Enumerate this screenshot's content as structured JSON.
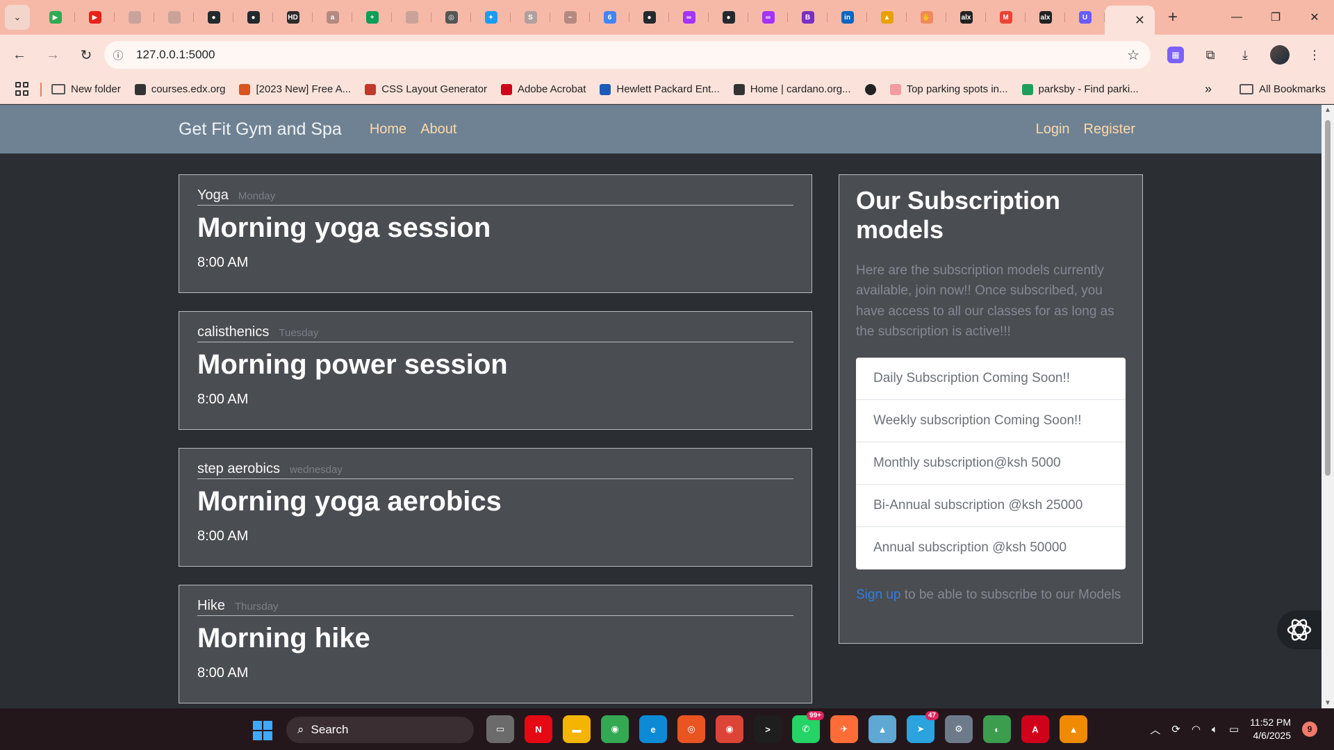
{
  "browser": {
    "tab_favicons": [
      {
        "icon": "google-play-icon",
        "color": "#34a853",
        "glyph": "▶"
      },
      {
        "icon": "youtube-icon",
        "color": "#e62117",
        "glyph": "▶"
      },
      {
        "icon": "blank-globe-icon",
        "color": "#c9a39a",
        "glyph": ""
      },
      {
        "icon": "blank-globe-icon",
        "color": "#c9a39a",
        "glyph": ""
      },
      {
        "icon": "github-icon",
        "color": "#24292e",
        "glyph": "●"
      },
      {
        "icon": "github-icon",
        "color": "#24292e",
        "glyph": "●"
      },
      {
        "icon": "hd-icon",
        "color": "#2d2d2d",
        "glyph": "HD"
      },
      {
        "icon": "alx-icon",
        "color": "#b48a80",
        "glyph": "a"
      },
      {
        "icon": "sheets-plus-icon",
        "color": "#0f9d58",
        "glyph": "+"
      },
      {
        "icon": "blank-globe-icon",
        "color": "#c9a39a",
        "glyph": ""
      },
      {
        "icon": "target-icon",
        "color": "#555555",
        "glyph": "◎"
      },
      {
        "icon": "twitter-icon",
        "color": "#1d9bf0",
        "glyph": "✦"
      },
      {
        "icon": "s-circle-icon",
        "color": "#b0a09c",
        "glyph": "S"
      },
      {
        "icon": "dash-icon",
        "color": "#b48a80",
        "glyph": "~"
      },
      {
        "icon": "google-calendar-icon",
        "color": "#4285f4",
        "glyph": "6"
      },
      {
        "icon": "github-icon",
        "color": "#24292e",
        "glyph": "●"
      },
      {
        "icon": "messenger-icon",
        "color": "#a334fa",
        "glyph": "∞"
      },
      {
        "icon": "github-icon",
        "color": "#24292e",
        "glyph": "●"
      },
      {
        "icon": "messenger-icon",
        "color": "#a334fa",
        "glyph": "∞"
      },
      {
        "icon": "b-icon",
        "color": "#7b2fbe",
        "glyph": "B"
      },
      {
        "icon": "linkedin-icon",
        "color": "#0a66c2",
        "glyph": "in"
      },
      {
        "icon": "charts-icon",
        "color": "#e8a200",
        "glyph": "▲"
      },
      {
        "icon": "hand-icon",
        "color": "#f08a5d",
        "glyph": "✋"
      },
      {
        "icon": "alx-icon",
        "color": "#222222",
        "glyph": "alx"
      },
      {
        "icon": "gmail-icon",
        "color": "#ea4335",
        "glyph": "M"
      },
      {
        "icon": "alx-icon",
        "color": "#222222",
        "glyph": "alx"
      },
      {
        "icon": "u-icon",
        "color": "#6a5cff",
        "glyph": "U"
      }
    ],
    "address": "127.0.0.1:5000",
    "bookmarks": [
      {
        "label": "New folder",
        "color": "#555555"
      },
      {
        "label": "courses.edx.org",
        "color": "#333333"
      },
      {
        "label": "[2023 New] Free A...",
        "color": "#d9541e"
      },
      {
        "label": "CSS Layout Generator",
        "color": "#c0392b"
      },
      {
        "label": "Adobe Acrobat",
        "color": "#d0021b"
      },
      {
        "label": "Hewlett Packard Ent...",
        "color": "#1c5bb7"
      },
      {
        "label": "Home | cardano.org...",
        "color": "#333333"
      },
      {
        "label": "",
        "color": "#222222"
      },
      {
        "label": "Top parking spots in...",
        "color": "#f39ca0"
      },
      {
        "label": "parksby - Find parki...",
        "color": "#1e9e5a"
      }
    ],
    "all_bookmarks_label": "All Bookmarks",
    "more_label": "»"
  },
  "site": {
    "brand": "Get Fit Gym and Spa",
    "nav": {
      "home": "Home",
      "about": "About",
      "login": "Login",
      "register": "Register"
    }
  },
  "classes": [
    {
      "category": "Yoga",
      "day": "Monday",
      "title": "Morning yoga session",
      "time": "8:00 AM"
    },
    {
      "category": "calisthenics",
      "day": "Tuesday",
      "title": "Morning power session",
      "time": "8:00 AM"
    },
    {
      "category": "step aerobics",
      "day": "wednesday",
      "title": "Morning yoga aerobics",
      "time": "8:00 AM"
    },
    {
      "category": "Hike",
      "day": "Thursday",
      "title": "Morning hike",
      "time": "8:00 AM"
    }
  ],
  "subscriptions": {
    "title": "Our Subscription models",
    "description": "Here are the subscription models currently available, join now!! Once subscribed, you have access to all our classes for as long as the subscription is active!!!",
    "items": [
      "Daily Subscription Coming Soon!!",
      "Weekly subscription Coming Soon!!",
      "Monthly subscription@ksh 5000",
      "Bi-Annual subscription @ksh 25000",
      "Annual subscription @ksh 50000"
    ],
    "signup_link": "Sign up",
    "signup_text": " to be able to subscribe to our Models"
  },
  "taskbar": {
    "search_label": "Search",
    "apps": [
      {
        "icon": "task-view-icon",
        "color": "#6b6b6b",
        "glyph": "▭",
        "badge": ""
      },
      {
        "icon": "netflix-icon",
        "color": "#e50914",
        "glyph": "N",
        "badge": ""
      },
      {
        "icon": "file-explorer-icon",
        "color": "#f4b400",
        "glyph": "▬",
        "badge": ""
      },
      {
        "icon": "chrome-icon",
        "color": "#34a853",
        "glyph": "◉",
        "badge": ""
      },
      {
        "icon": "edge-icon",
        "color": "#0c8ad6",
        "glyph": "e",
        "badge": ""
      },
      {
        "icon": "ubuntu-icon",
        "color": "#e95420",
        "glyph": "◎",
        "badge": ""
      },
      {
        "icon": "chrome-icon",
        "color": "#db4437",
        "glyph": "◉",
        "badge": ""
      },
      {
        "icon": "terminal-icon",
        "color": "#1e1e1e",
        "glyph": ">",
        "badge": ""
      },
      {
        "icon": "whatsapp-icon",
        "color": "#25d366",
        "glyph": "✆",
        "badge": "99+"
      },
      {
        "icon": "postman-icon",
        "color": "#ff6c37",
        "glyph": "✈",
        "badge": ""
      },
      {
        "icon": "photos-icon",
        "color": "#5fa8d3",
        "glyph": "▲",
        "badge": ""
      },
      {
        "icon": "telegram-icon",
        "color": "#2aa3df",
        "glyph": "➤",
        "badge": "47"
      },
      {
        "icon": "settings-icon",
        "color": "#6d7a8a",
        "glyph": "⚙",
        "badge": ""
      },
      {
        "icon": "globe-app-icon",
        "color": "#3c9d4f",
        "glyph": "◐",
        "badge": ""
      },
      {
        "icon": "acrobat-icon",
        "color": "#d0021b",
        "glyph": "A",
        "badge": ""
      },
      {
        "icon": "vlc-icon",
        "color": "#f08a00",
        "glyph": "▲",
        "badge": ""
      }
    ],
    "time": "11:52 PM",
    "date": "4/6/2025",
    "notifications": "9"
  }
}
